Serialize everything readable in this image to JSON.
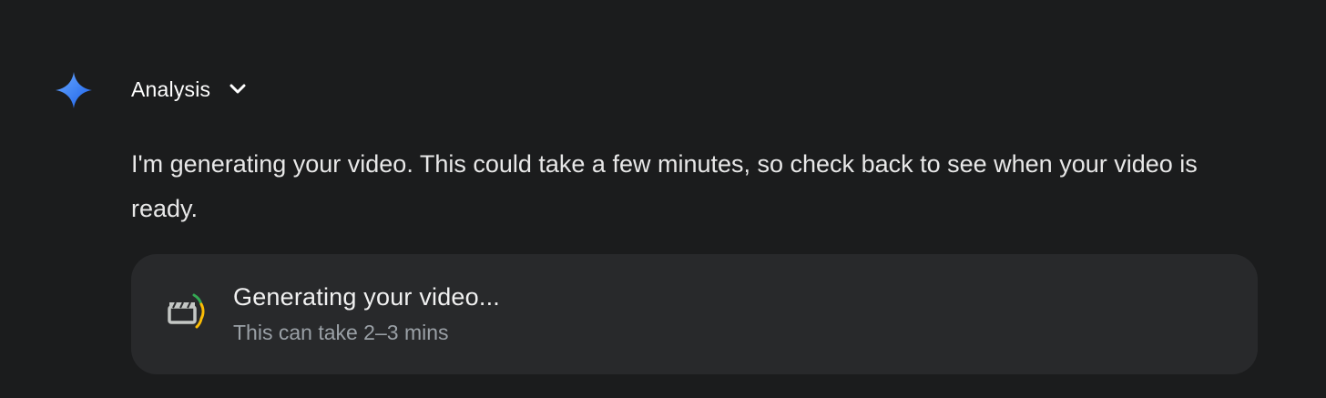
{
  "response": {
    "avatar_icon": "gemini-sparkle-icon",
    "analysis": {
      "label": "Analysis",
      "toggle_icon": "chevron-down-icon"
    },
    "message": "I'm generating your video. This could take a few minutes, so check back to see when your video is ready."
  },
  "progress_card": {
    "icon": "clapperboard-icon",
    "title": "Generating your video...",
    "subtitle": "This can take 2–3 mins"
  },
  "colors": {
    "background": "#1b1c1d",
    "card_background": "#28292b",
    "sparkle_gradient": [
      "#4f8ff7",
      "#1a5ee8"
    ],
    "spinner_green": "#34a853",
    "spinner_yellow": "#fbbc04"
  }
}
